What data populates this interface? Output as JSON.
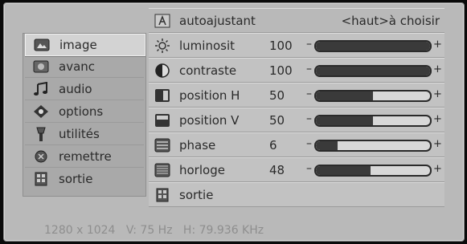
{
  "header": {
    "title": "autoajustant",
    "hint": "<haut>à choisir"
  },
  "sidebar": {
    "items": [
      {
        "label": "image",
        "icon": "image-icon",
        "selected": true
      },
      {
        "label": "avanc",
        "icon": "advanced-icon",
        "selected": false
      },
      {
        "label": "audio",
        "icon": "music-note-icon",
        "selected": false
      },
      {
        "label": "options",
        "icon": "options-icon",
        "selected": false
      },
      {
        "label": "utilités",
        "icon": "tools-icon",
        "selected": false
      },
      {
        "label": "remettre",
        "icon": "reset-icon",
        "selected": false
      },
      {
        "label": "sortie",
        "icon": "exit-icon",
        "selected": false
      }
    ]
  },
  "settings": [
    {
      "label": "luminosit",
      "value": "100",
      "level": 1.0,
      "icon": "brightness-icon"
    },
    {
      "label": "contraste",
      "value": "100",
      "level": 1.0,
      "icon": "contrast-icon"
    },
    {
      "label": "position H",
      "value": "50",
      "level": 0.5,
      "icon": "h-position-icon"
    },
    {
      "label": "position V",
      "value": "50",
      "level": 0.5,
      "icon": "v-position-icon"
    },
    {
      "label": "phase",
      "value": "6",
      "level": 0.19,
      "icon": "phase-icon"
    },
    {
      "label": "horloge",
      "value": "48",
      "level": 0.48,
      "icon": "clock-icon"
    }
  ],
  "slider_symbols": {
    "minus": "–",
    "plus": "+"
  },
  "exit_row": {
    "label": "sortie",
    "icon": "exit-icon"
  },
  "status": {
    "resolution": "1280 x 1024",
    "vfreq": "V: 75 Hz",
    "hfreq": "H: 79.936 KHz"
  },
  "colors": {
    "panel": "#b9b9b9",
    "row": "#c2c2c2",
    "text": "#2a2a2a",
    "status_text": "#8e8e8e",
    "slider_fill": "#3a3a3a"
  }
}
